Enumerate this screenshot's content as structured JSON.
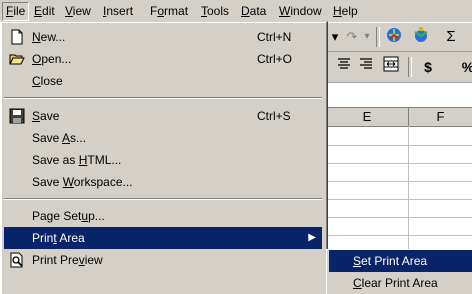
{
  "menubar": {
    "items": [
      {
        "label": "File",
        "active": true
      },
      {
        "label": "Edit"
      },
      {
        "label": "View"
      },
      {
        "label": "Insert"
      },
      {
        "label": "Format"
      },
      {
        "label": "Tools"
      },
      {
        "label": "Data"
      },
      {
        "label": "Window"
      },
      {
        "label": "Help"
      }
    ]
  },
  "toolbar": {
    "undo_icon": "undo-icon",
    "redo_icon": "redo-icon",
    "hyperlink_icon": "insert-hyperlink-icon",
    "web_toolbar_icon": "web-toolbar-icon",
    "autosum_glyph": "Σ",
    "align_center_icon": "align-center-icon",
    "align_right_icon": "align-right-icon",
    "merge_center_icon": "merge-and-center-icon",
    "currency_glyph": "$",
    "percent_glyph": "%"
  },
  "grid": {
    "columns": [
      "E",
      "F"
    ]
  },
  "file_menu": {
    "items": [
      {
        "label": "New...",
        "shortcut": "Ctrl+N",
        "icon": "new-document-icon"
      },
      {
        "label": "Open...",
        "shortcut": "Ctrl+O",
        "icon": "open-folder-icon"
      },
      {
        "label": "Close",
        "shortcut": ""
      },
      {
        "label": "Save",
        "shortcut": "Ctrl+S",
        "icon": "save-disk-icon"
      },
      {
        "label": "Save As...",
        "shortcut": ""
      },
      {
        "label": "Save as HTML...",
        "shortcut": ""
      },
      {
        "label": "Save Workspace...",
        "shortcut": ""
      },
      {
        "label": "Page Setup...",
        "shortcut": ""
      },
      {
        "label": "Print Area",
        "shortcut": "",
        "submenu": true,
        "highlighted": true
      },
      {
        "label": "Print Preview",
        "shortcut": "",
        "icon": "print-preview-icon"
      }
    ]
  },
  "print_area_submenu": {
    "items": [
      {
        "label": "Set Print Area",
        "highlighted": true
      },
      {
        "label": "Clear Print Area"
      }
    ]
  },
  "colors": {
    "face": "#d4d0c8",
    "highlight": "#0a246a",
    "highlight_text": "#ffffff"
  }
}
